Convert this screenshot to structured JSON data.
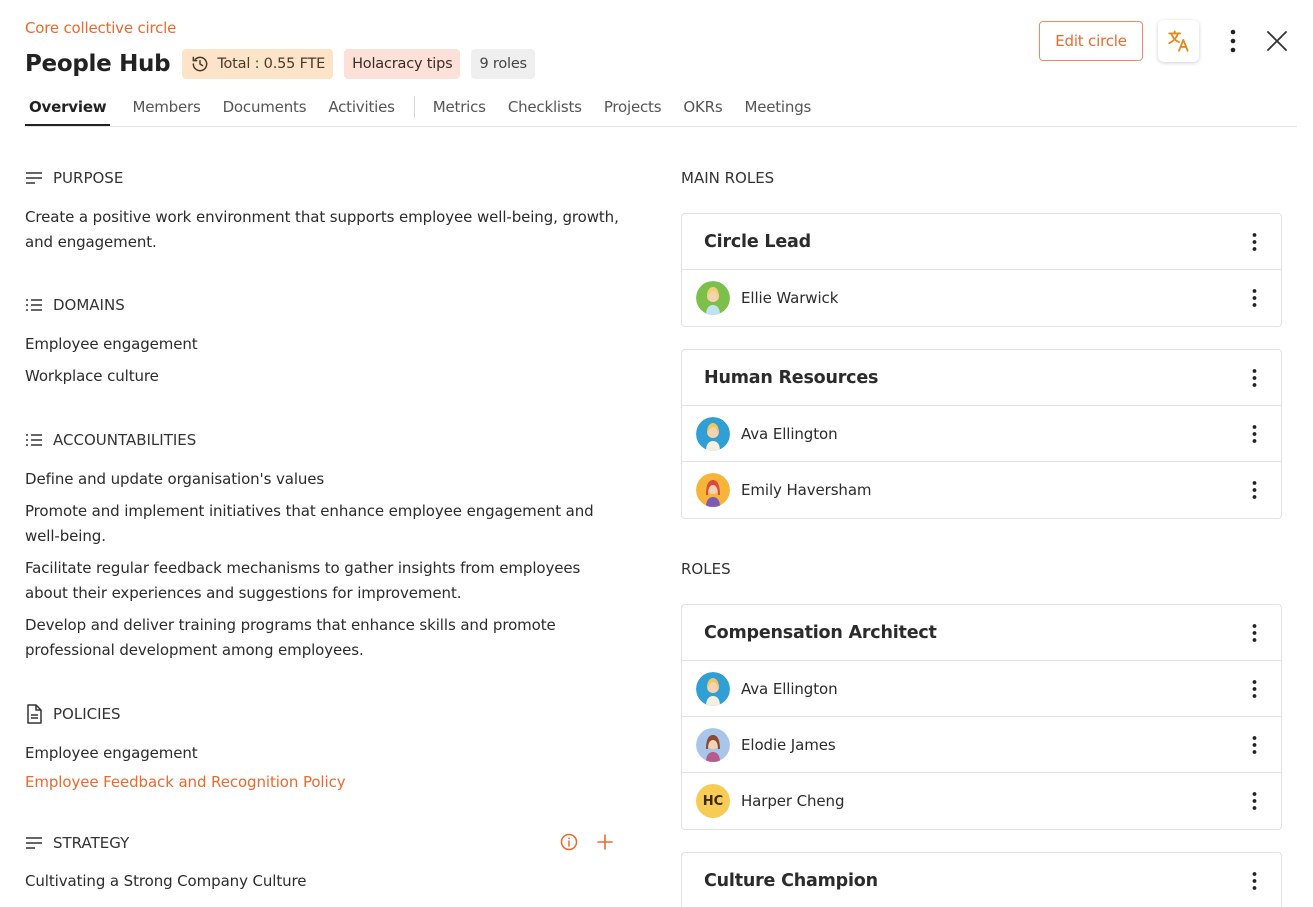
{
  "header": {
    "breadcrumb": "Core collective circle",
    "title": "People Hub",
    "badges": {
      "fte": "Total : 0.55 FTE",
      "tips": "Holacracy tips",
      "roles": "9 roles"
    },
    "edit_label": "Edit circle",
    "icons": {
      "history": "history-icon",
      "translate": "translate-icon",
      "more": "more-vert-icon",
      "close": "close-icon"
    }
  },
  "tabs": [
    {
      "label": "Overview",
      "active": true
    },
    {
      "label": "Members"
    },
    {
      "label": "Documents"
    },
    {
      "label": "Activities"
    },
    {
      "label": "Metrics"
    },
    {
      "label": "Checklists"
    },
    {
      "label": "Projects"
    },
    {
      "label": "OKRs"
    },
    {
      "label": "Meetings"
    }
  ],
  "left": {
    "purpose": {
      "heading": "PURPOSE",
      "text": "Create a positive work environment that supports employee well-being, growth, and engagement."
    },
    "domains": {
      "heading": "DOMAINS",
      "items": [
        "Employee engagement",
        "Workplace culture"
      ]
    },
    "accountabilities": {
      "heading": "ACCOUNTABILITIES",
      "items": [
        "Define and update organisation's values",
        "Promote and implement initiatives that enhance employee engagement and well-being.",
        "Facilitate regular feedback mechanisms to gather insights from employees about their experiences and suggestions for improvement.",
        "Develop and deliver training programs that enhance skills and promote professional development among employees."
      ]
    },
    "policies": {
      "heading": "POLICIES",
      "items": [
        "Employee engagement",
        "Employee Feedback and Recognition Policy"
      ]
    },
    "strategy": {
      "heading": "STRATEGY",
      "text": "Cultivating a Strong Company Culture"
    }
  },
  "right": {
    "main_roles_heading": "MAIN ROLES",
    "roles_heading": "ROLES",
    "main_roles": [
      {
        "title": "Circle Lead",
        "members": [
          {
            "name": "Ellie Warwick",
            "avatar": "green"
          }
        ]
      },
      {
        "title": "Human Resources",
        "members": [
          {
            "name": "Ava Ellington",
            "avatar": "blue"
          },
          {
            "name": "Emily Haversham",
            "avatar": "orange"
          }
        ]
      }
    ],
    "roles": [
      {
        "title": "Compensation Architect",
        "members": [
          {
            "name": "Ava Ellington",
            "avatar": "blue"
          },
          {
            "name": "Elodie James",
            "avatar": "lavender"
          },
          {
            "name": "Harper Cheng",
            "initials": "HC"
          }
        ]
      },
      {
        "title": "Culture Champion",
        "members": []
      }
    ]
  },
  "colors": {
    "accent": "#ea6a2e",
    "fte_badge": "#fde4c9",
    "tips_badge": "#fde1d9",
    "roles_badge": "#efefef"
  }
}
